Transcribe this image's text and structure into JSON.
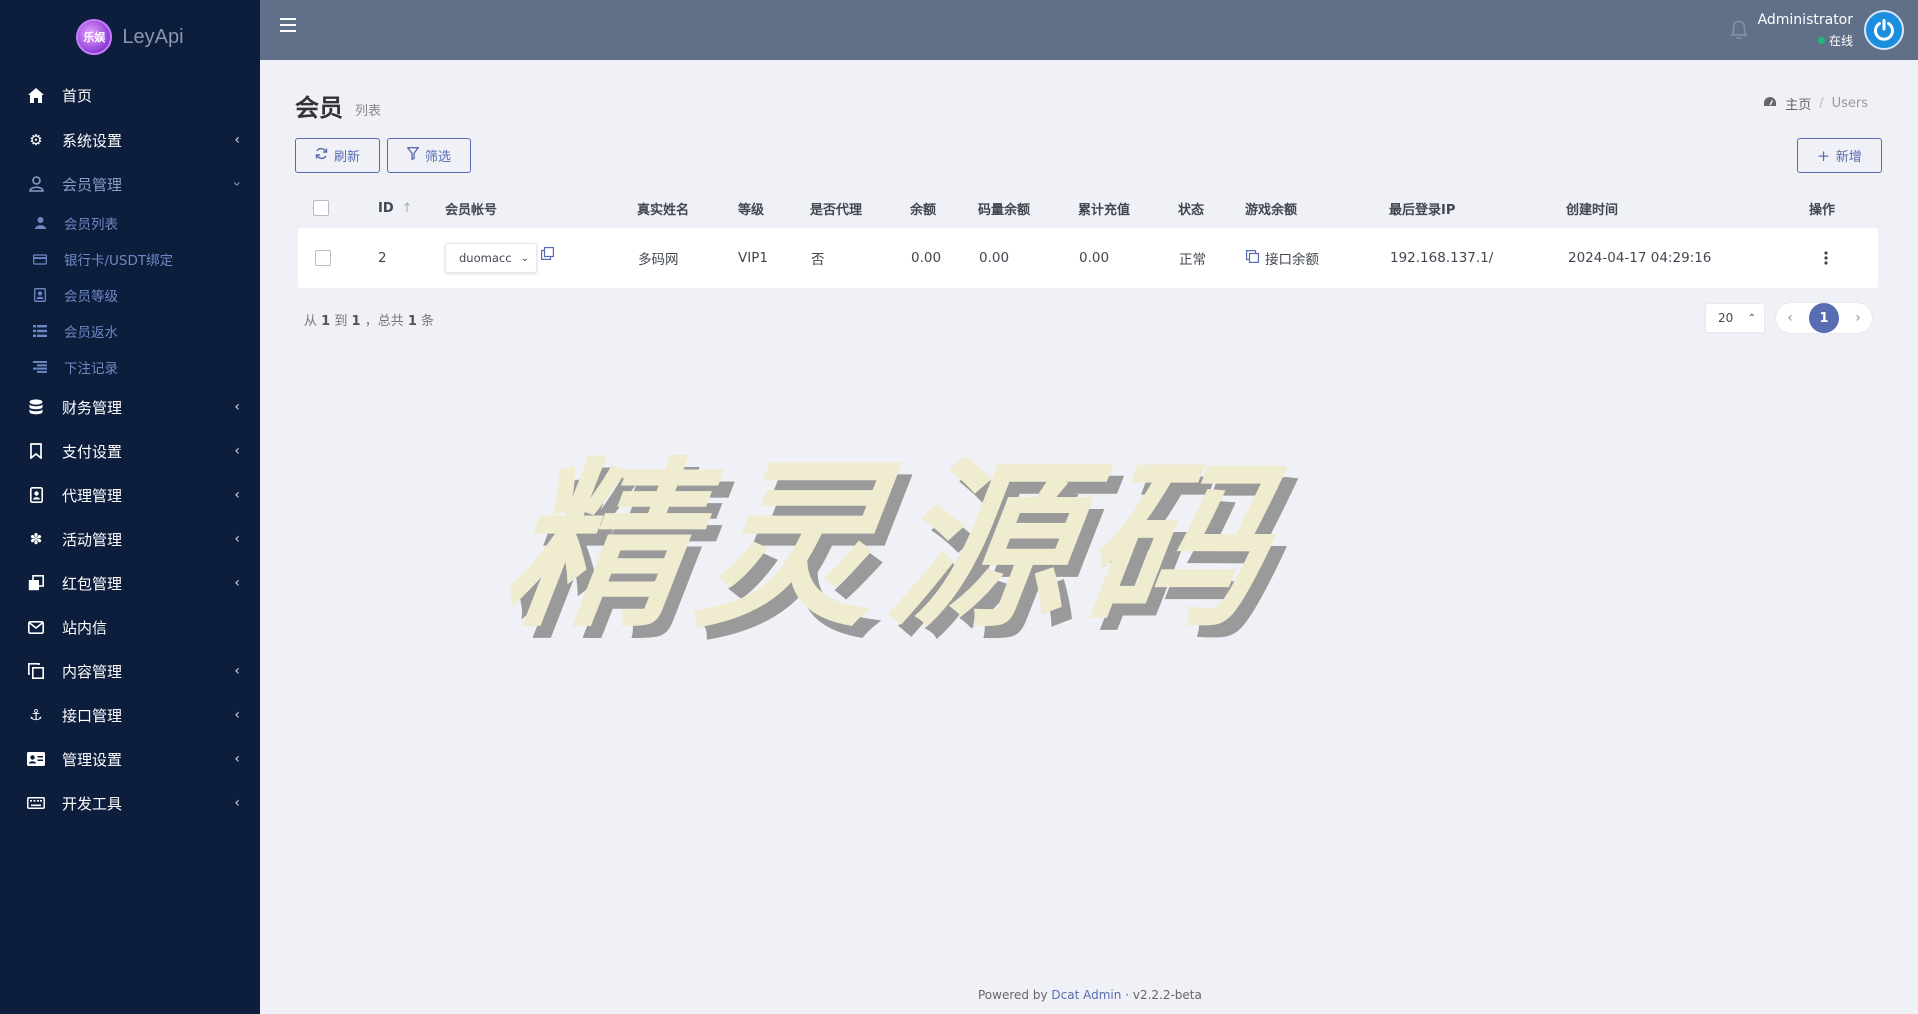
{
  "brand": {
    "logo_text": "乐娱",
    "name": "LeyApi"
  },
  "sidebar": {
    "items": [
      {
        "label": "首页",
        "icon": "home-icon",
        "arrow": ""
      },
      {
        "label": "系统设置",
        "icon": "gears-icon",
        "arrow": "‹"
      },
      {
        "label": "会员管理",
        "icon": "user-icon",
        "arrow": "‹"
      },
      {
        "label": "财务管理",
        "icon": "database-icon",
        "arrow": "‹"
      },
      {
        "label": "支付设置",
        "icon": "bookmark-icon",
        "arrow": "‹"
      },
      {
        "label": "代理管理",
        "icon": "id-badge-icon",
        "arrow": "‹"
      },
      {
        "label": "活动管理",
        "icon": "yelp-icon",
        "arrow": "‹"
      },
      {
        "label": "红包管理",
        "icon": "clone-icon",
        "arrow": "‹"
      },
      {
        "label": "站内信",
        "icon": "envelope-icon",
        "arrow": ""
      },
      {
        "label": "内容管理",
        "icon": "copy-icon",
        "arrow": "‹"
      },
      {
        "label": "接口管理",
        "icon": "anchor-icon",
        "arrow": "‹"
      },
      {
        "label": "管理设置",
        "icon": "address-card-icon",
        "arrow": "‹"
      },
      {
        "label": "开发工具",
        "icon": "keyboard-icon",
        "arrow": "‹"
      }
    ],
    "subitems": [
      {
        "label": "会员列表",
        "icon": "user-small-icon"
      },
      {
        "label": "银行卡/USDT绑定",
        "icon": "credit-card-icon"
      },
      {
        "label": "会员等级",
        "icon": "portrait-icon"
      },
      {
        "label": "会员返水",
        "icon": "list-icon"
      },
      {
        "label": "下注记录",
        "icon": "align-right-icon"
      }
    ]
  },
  "header": {
    "user_name": "Administrator",
    "user_status": "在线"
  },
  "page": {
    "title": "会员",
    "subtitle": "列表",
    "breadcrumb_home": "主页",
    "breadcrumb_current": "Users"
  },
  "toolbar": {
    "refresh_label": "刷新",
    "filter_label": "筛选",
    "create_label": "新增"
  },
  "table": {
    "columns": {
      "id": "ID",
      "account": "会员帐号",
      "real_name": "真实姓名",
      "level": "等级",
      "is_agent": "是否代理",
      "balance": "余额",
      "code_balance": "码量余额",
      "total_recharge": "累计充值",
      "status": "状态",
      "game_balance": "游戏余额",
      "last_ip": "最后登录IP",
      "created_at": "创建时间",
      "actions": "操作"
    },
    "rows": [
      {
        "id": "2",
        "account": "duomacc",
        "real_name": "多码网",
        "level": "VIP1",
        "is_agent": "否",
        "balance": "0.00",
        "code_balance": "0.00",
        "total_recharge": "0.00",
        "status": "正常",
        "game_balance": "接口余额",
        "last_ip": "192.168.137.1/",
        "created_at": "2024-04-17 04:29:16"
      }
    ]
  },
  "pagination": {
    "summary_prefix": "从",
    "from": "1",
    "to_word": "到",
    "to": "1",
    "total_word": "，总共",
    "total": "1",
    "unit": "条",
    "per_page": "20",
    "current_page": "1"
  },
  "watermark": "精灵源码",
  "footer": {
    "powered_by": "Powered by",
    "link": "Dcat Admin",
    "separator": "·",
    "version": "v2.2.2-beta"
  },
  "colors": {
    "sidebar_bg": "#0d1e3d",
    "header_bg": "#5f7088",
    "accent": "#586cb1",
    "online": "#21b978"
  }
}
